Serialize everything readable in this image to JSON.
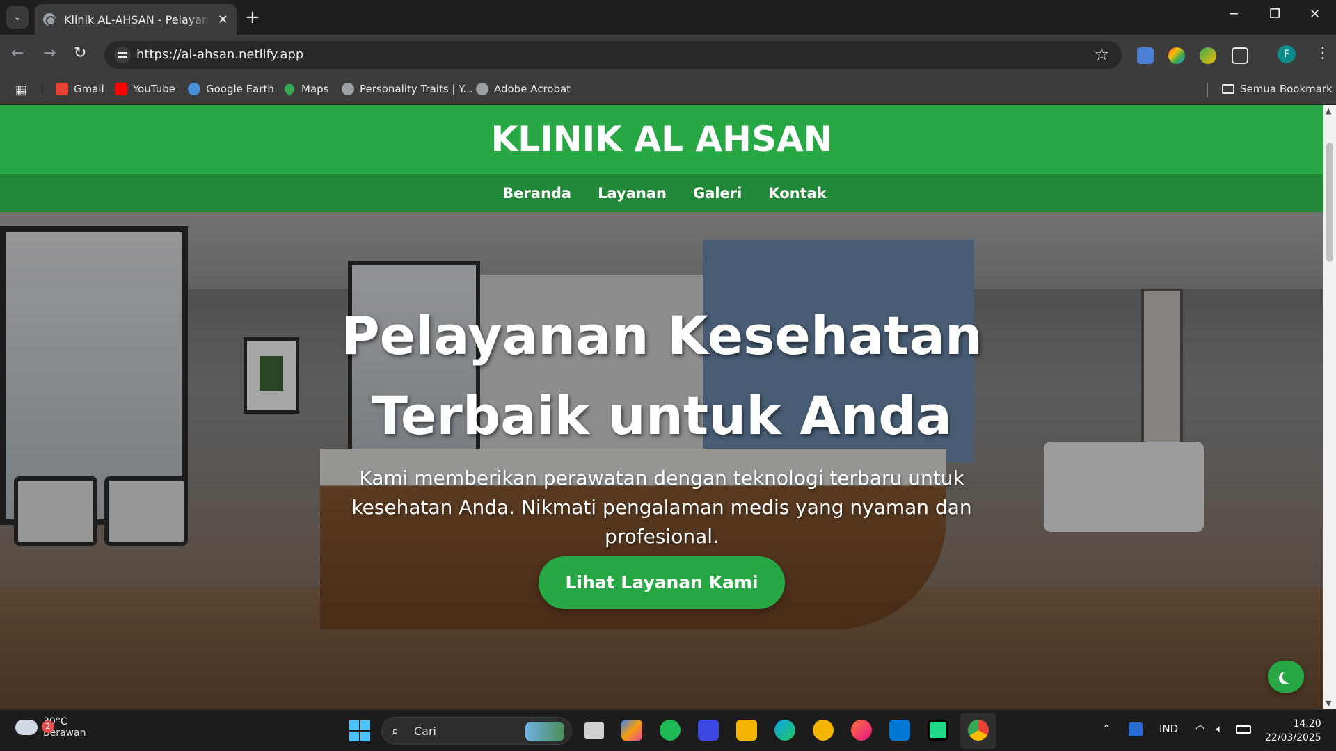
{
  "browser": {
    "tab_title": "Klinik AL-AHSAN - Pelayanan Kesehatan",
    "tab_close": "✕",
    "new_tab": "+",
    "url": "https://al-ahsan.netlify.app",
    "profile_initial": "F",
    "window_controls": {
      "minimize": "─",
      "restore": "❐",
      "close": "✕"
    },
    "nav": {
      "back": "←",
      "forward": "→",
      "reload": "↻"
    },
    "bookmarks": [
      {
        "label": "Gmail",
        "icon": "gmail-icon",
        "color": "#ea4335"
      },
      {
        "label": "YouTube",
        "icon": "youtube-icon",
        "color": "#ff0000"
      },
      {
        "label": "Google Earth",
        "icon": "google-earth-icon",
        "color": "#4a90d9"
      },
      {
        "label": "Maps",
        "icon": "maps-icon",
        "color": "#34a853"
      },
      {
        "label": "Personality Traits | Y...",
        "icon": "personality-icon",
        "color": "#9aa0a6"
      },
      {
        "label": "Adobe Acrobat",
        "icon": "globe-icon",
        "color": "#9aa0a6"
      }
    ],
    "all_bookmarks": "Semua Bookmark"
  },
  "site": {
    "logo": "KLINIK AL AHSAN",
    "nav": [
      "Beranda",
      "Layanan",
      "Galeri",
      "Kontak"
    ],
    "hero": {
      "title_line1": "Pelayanan Kesehatan",
      "title_line2": "Terbaik untuk Anda",
      "subtitle": "Kami memberikan perawatan dengan teknologi terbaru untuk kesehatan Anda. Nikmati pengalaman medis yang nyaman dan profesional.",
      "cta": "Lihat Layanan Kami"
    },
    "accent_color": "#28a745",
    "nav_color": "#218838"
  },
  "taskbar": {
    "weather_badge": "2",
    "temperature": "30°C",
    "condition": "Berawan",
    "search_placeholder": "Cari",
    "language": "IND",
    "time": "14.20",
    "date": "22/03/2025"
  }
}
